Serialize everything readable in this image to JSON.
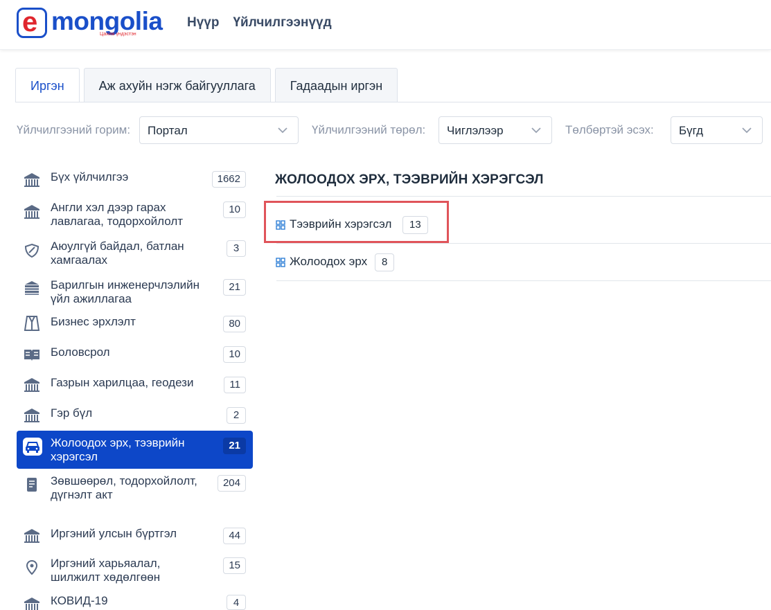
{
  "header": {
    "logo_e": "e",
    "logo_text": "mongolia",
    "logo_sub": "Цахим үндэстэн",
    "nav": [
      "Нүүр",
      "Үйлчилгээнүүд"
    ]
  },
  "tabs": [
    "Иргэн",
    "Аж ахуйн нэгж байгууллага",
    "Гадаадын иргэн"
  ],
  "filters": {
    "mode_label": "Үйлчилгээний горим:",
    "mode_value": "Портал",
    "type_label": "Үйлчилгээний төрөл:",
    "type_value": "Чиглэлээр",
    "paid_label": "Төлбөртэй эсэх:",
    "paid_value": "Бүгд"
  },
  "categories": [
    {
      "label": "Бүх үйлчилгээ",
      "count": "1662",
      "icon": "building-icon"
    },
    {
      "label": "Англи хэл дээр гарах лавлагаа, тодорхойлолт",
      "count": "10",
      "icon": "building-icon"
    },
    {
      "label": "Аюулгүй байдал, батлан хамгаалах",
      "count": "3",
      "icon": "shield-icon"
    },
    {
      "label": "Барилгын инженерчлэлийн үйл ажиллагаа",
      "count": "21",
      "icon": "construction-icon"
    },
    {
      "label": "Бизнес эрхлэлт",
      "count": "80",
      "icon": "suit-icon"
    },
    {
      "label": "Боловсрол",
      "count": "10",
      "icon": "book-icon"
    },
    {
      "label": "Газрын харилцаа, геодези",
      "count": "11",
      "icon": "building-icon"
    },
    {
      "label": "Гэр бүл",
      "count": "2",
      "icon": "building-icon"
    },
    {
      "label": "Жолоодох эрх, тээврийн хэрэгсэл",
      "count": "21",
      "icon": "car-icon"
    },
    {
      "label": "Зөвшөөрөл, тодорхойлолт, дүгнэлт акт",
      "count": "204",
      "icon": "document-icon"
    },
    {
      "label": "Иргэний улсын бүртгэл",
      "count": "44",
      "icon": "building-icon"
    },
    {
      "label": "Иргэний харьяалал, шилжилт хөдөлгөөн",
      "count": "15",
      "icon": "location-pin-icon"
    },
    {
      "label": "КОВИД-19",
      "count": "4",
      "icon": "building-icon"
    }
  ],
  "main": {
    "title": "ЖОЛООДОХ ЭРХ, ТЭЭВРИЙН ХЭРЭГСЭЛ",
    "subcategories": [
      {
        "name": "Тээврийн хэрэгсэл",
        "count": "13"
      },
      {
        "name": "Жолоодох эрх",
        "count": "8"
      }
    ]
  },
  "colors": {
    "accent": "#0d47c8",
    "logo_red": "#e0262d",
    "highlight": "#e0545a"
  }
}
